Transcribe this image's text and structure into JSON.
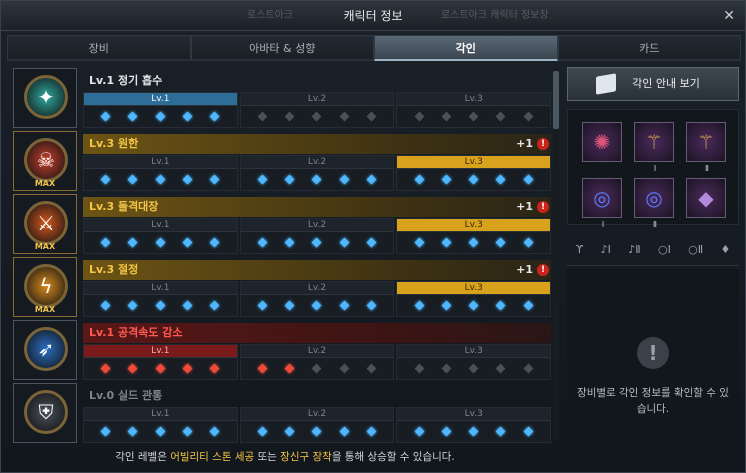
{
  "window": {
    "title": "캐릭터 정보",
    "close_glyph": "✕",
    "bg_left": "로스트아크",
    "bg_right": "로스트아크 캐릭터 정보창"
  },
  "tabs": [
    {
      "label": "장비",
      "active": false
    },
    {
      "label": "아바타 & 성향",
      "active": false
    },
    {
      "label": "각인",
      "active": true
    },
    {
      "label": "카드",
      "active": false
    }
  ],
  "engravings": [
    {
      "title": "Lv.1 정기 흡수",
      "style": "plain",
      "max": false,
      "bonus": "",
      "icon": "drain-icon",
      "icon_glyph": "✦",
      "icon_color": "#2fa9a0",
      "active_level": 1,
      "bar_color": "blue",
      "gems": [
        "blue",
        "blue",
        "blue",
        "blue",
        "blue",
        "off",
        "off",
        "off",
        "off",
        "off",
        "off",
        "off",
        "off",
        "off",
        "off"
      ]
    },
    {
      "title": "Lv.3 원한",
      "style": "gold",
      "max": true,
      "bonus": "+1",
      "icon": "grudge-icon",
      "icon_glyph": "☠",
      "icon_color": "#c4402b",
      "active_level": 3,
      "bar_color": "gold",
      "gems": [
        "blue",
        "blue",
        "blue",
        "blue",
        "blue",
        "blue",
        "blue",
        "blue",
        "blue",
        "blue",
        "blue",
        "blue",
        "blue",
        "blue",
        "blue"
      ]
    },
    {
      "title": "Lv.3 돌격대장",
      "style": "gold",
      "max": true,
      "bonus": "+1",
      "icon": "raid-captain-icon",
      "icon_glyph": "⚔",
      "icon_color": "#d2581f",
      "active_level": 3,
      "bar_color": "gold",
      "gems": [
        "blue",
        "blue",
        "blue",
        "blue",
        "blue",
        "blue",
        "blue",
        "blue",
        "blue",
        "blue",
        "blue",
        "blue",
        "blue",
        "blue",
        "blue"
      ]
    },
    {
      "title": "Lv.3 절정",
      "style": "gold",
      "max": true,
      "bonus": "+1",
      "icon": "climax-icon",
      "icon_glyph": "ϟ",
      "icon_color": "#d6891e",
      "active_level": 3,
      "bar_color": "gold",
      "gems": [
        "blue",
        "blue",
        "blue",
        "blue",
        "blue",
        "blue",
        "blue",
        "blue",
        "blue",
        "blue",
        "blue",
        "blue",
        "blue",
        "blue",
        "blue"
      ]
    },
    {
      "title": "Lv.1 공격속도 감소",
      "style": "red",
      "max": false,
      "bonus": "",
      "icon": "attack-speed-down-icon",
      "icon_glyph": "➶",
      "icon_color": "#2a6fc4",
      "active_level": 1,
      "bar_color": "red",
      "gems": [
        "red",
        "red",
        "red",
        "red",
        "red",
        "red",
        "red",
        "off",
        "off",
        "off",
        "off",
        "off",
        "off",
        "off",
        "off"
      ]
    },
    {
      "title": "Lv.0 실드 관통",
      "style": "gray",
      "max": false,
      "bonus": "",
      "icon": "shield-pierce-icon",
      "icon_glyph": "⛨",
      "icon_color": "#4a525a",
      "active_level": 0,
      "bar_color": "none",
      "gems": [
        "blue",
        "blue",
        "blue",
        "blue",
        "blue",
        "blue",
        "blue",
        "blue",
        "blue",
        "blue",
        "blue",
        "blue",
        "blue",
        "blue",
        "blue"
      ]
    }
  ],
  "level_labels": [
    "Lv.1",
    "Lv.2",
    "Lv.3"
  ],
  "max_label": "MAX",
  "alert_glyph": "!",
  "footer": {
    "prefix": "각인 레벨은 ",
    "hl1": "어빌리티 스톤 세공",
    "mid": " 또는 ",
    "hl2": "장신구 장착",
    "suffix": "을 통해 상승할 수 있습니다."
  },
  "right": {
    "guide_button": "각인 안내 보기",
    "slots": [
      {
        "name": "necklace-slot",
        "icon": "necklace-icon",
        "glyph": "✺",
        "color": "#e0557a",
        "roman": ""
      },
      {
        "name": "earring-slot-1",
        "icon": "earring-icon",
        "glyph": "⚚",
        "color": "#d5a74c",
        "roman": "Ⅰ"
      },
      {
        "name": "earring-slot-2",
        "icon": "earring-icon",
        "glyph": "⚚",
        "color": "#d5a74c",
        "roman": "Ⅱ"
      },
      {
        "name": "ring-slot-1",
        "icon": "ring-icon",
        "glyph": "◎",
        "color": "#5a7bff",
        "roman": "Ⅰ"
      },
      {
        "name": "ring-slot-2",
        "icon": "ring-icon",
        "glyph": "◎",
        "color": "#5a7bff",
        "roman": "Ⅱ"
      },
      {
        "name": "ability-stone-slot",
        "icon": "stone-icon",
        "glyph": "◆",
        "color": "#b48bdc",
        "roman": ""
      }
    ],
    "stat_icons": [
      {
        "name": "necklace-stat-icon",
        "glyph": "ϒ"
      },
      {
        "name": "earring-1-stat-icon",
        "glyph": "♪Ⅰ"
      },
      {
        "name": "earring-2-stat-icon",
        "glyph": "♪Ⅱ"
      },
      {
        "name": "ring-1-stat-icon",
        "glyph": "○Ⅰ"
      },
      {
        "name": "ring-2-stat-icon",
        "glyph": "○Ⅱ"
      },
      {
        "name": "stone-stat-icon",
        "glyph": "♦"
      }
    ],
    "empty_glyph": "!",
    "empty_text": "장비별로 각인 정보를 확인할 수 있습니다."
  }
}
